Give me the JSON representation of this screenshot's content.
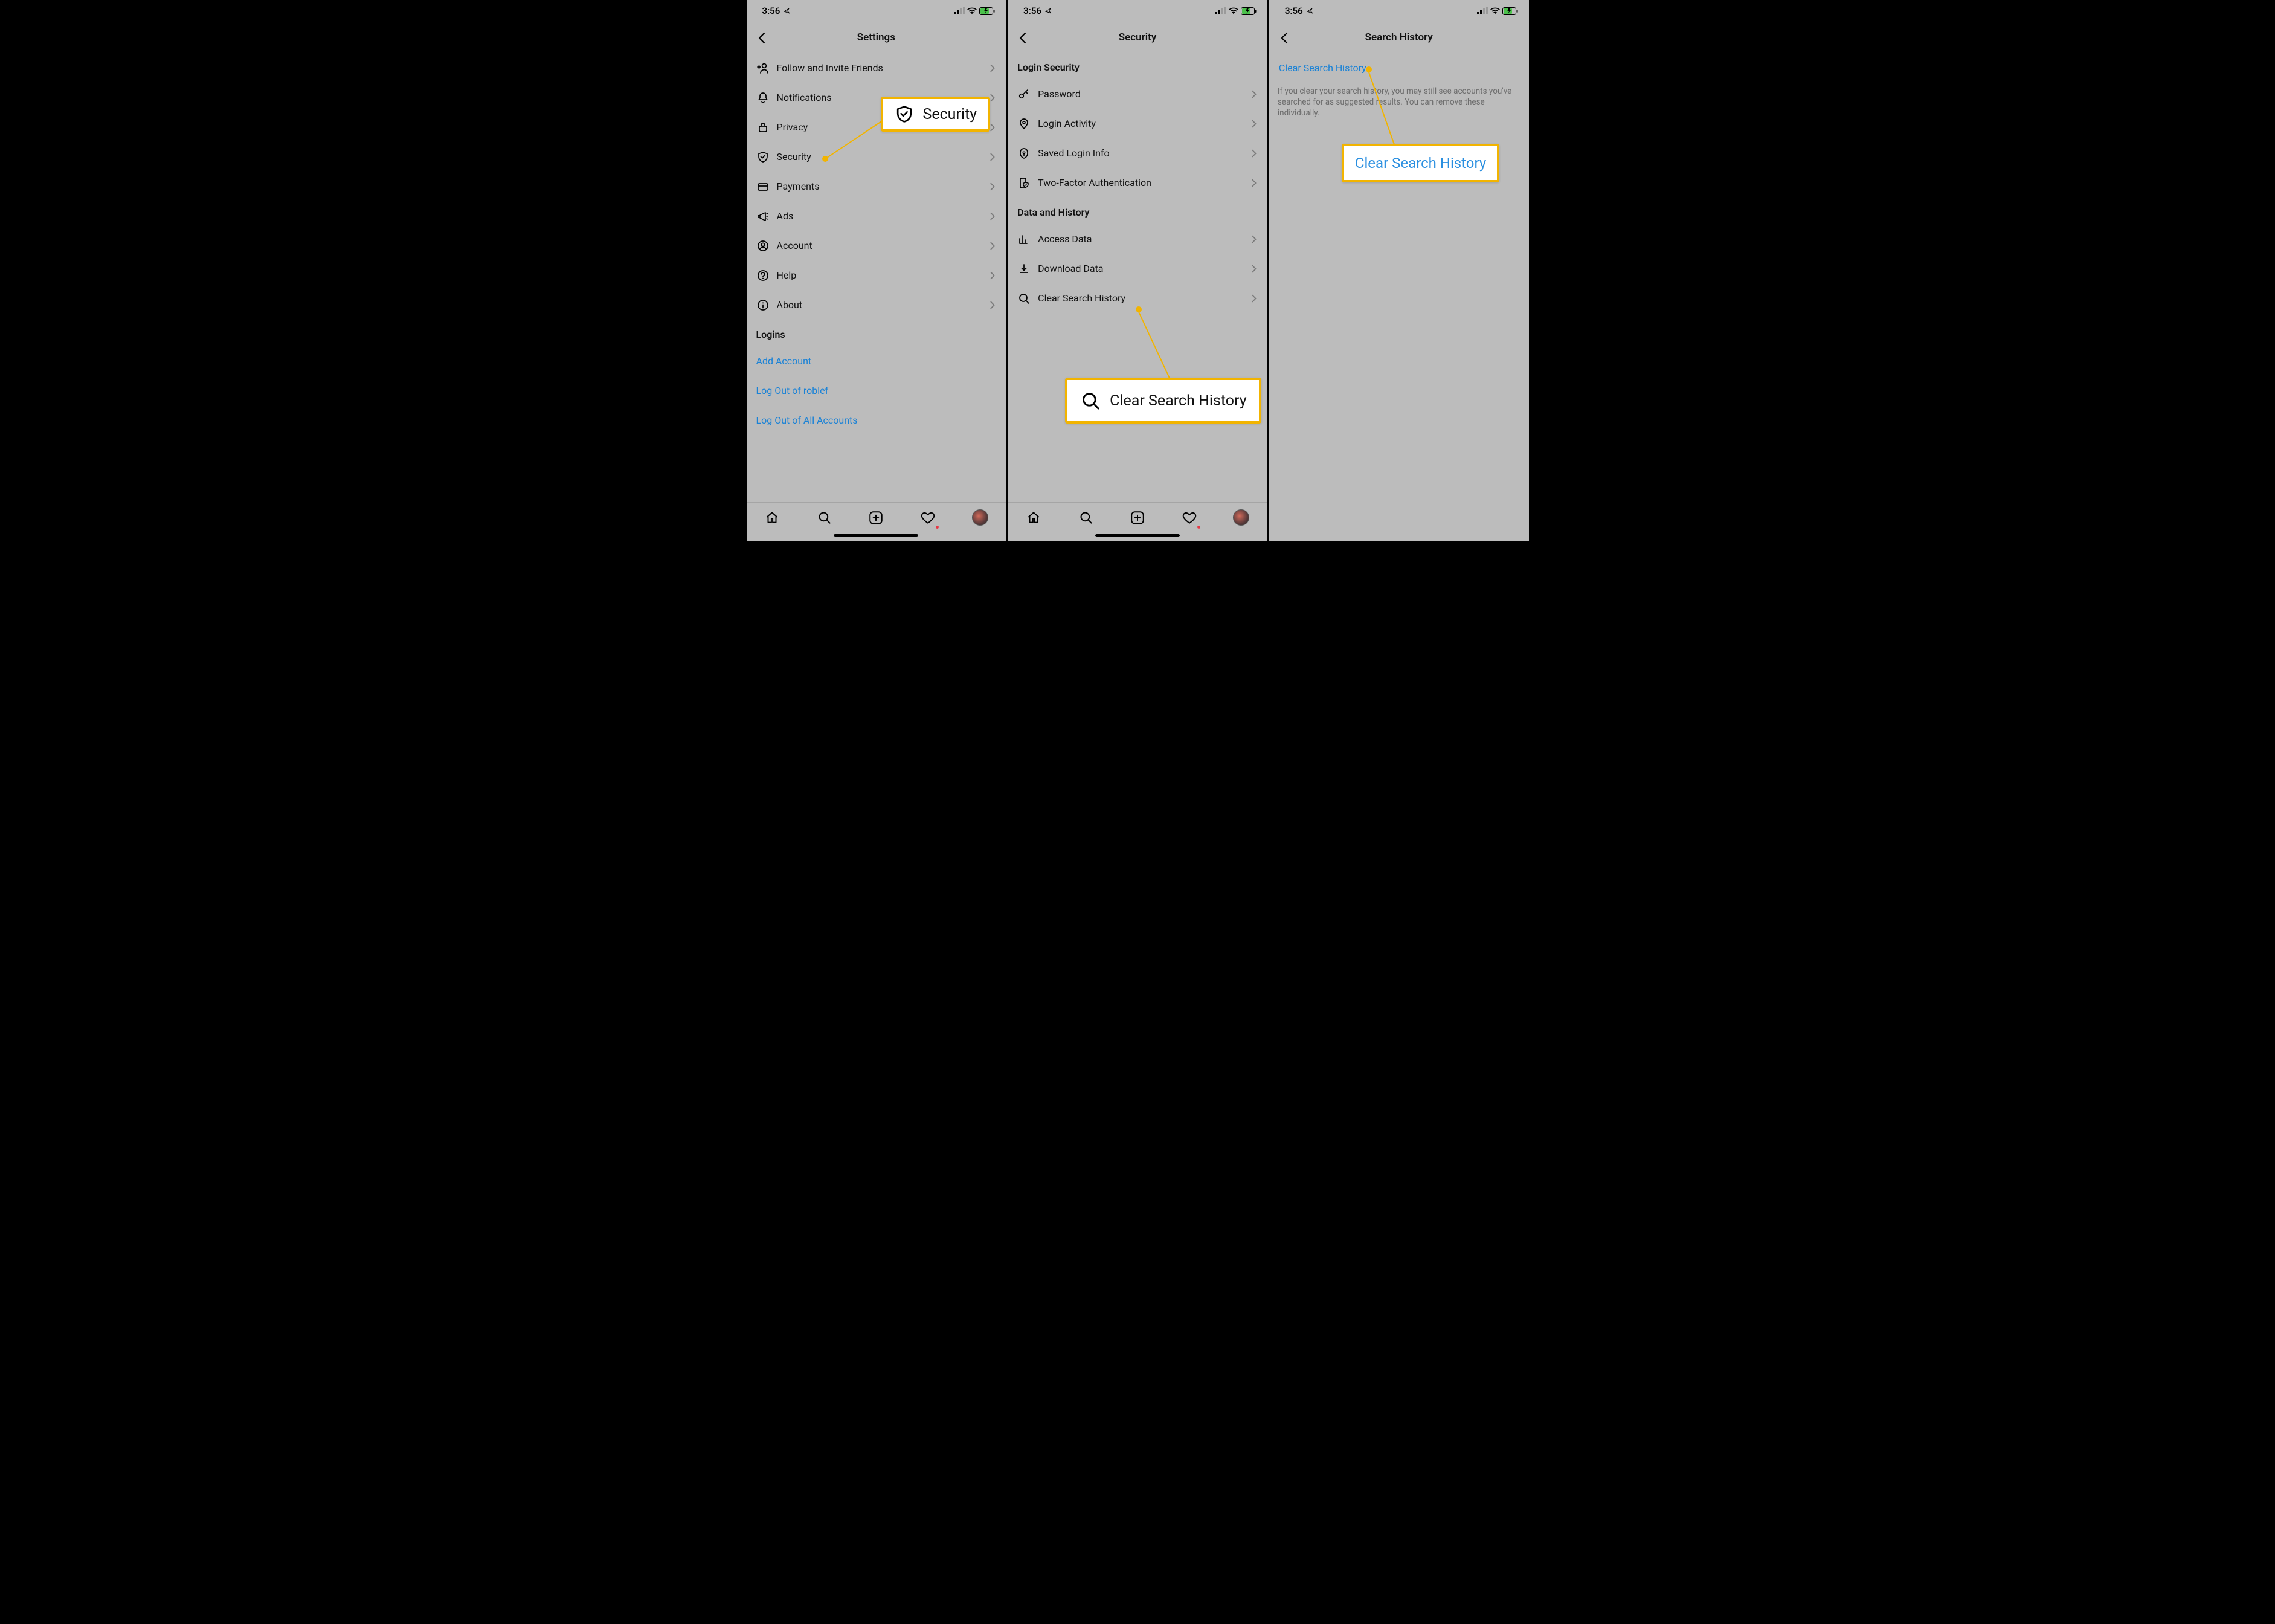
{
  "status": {
    "time": "3:56"
  },
  "screen1": {
    "title": "Settings",
    "items": [
      {
        "label": "Follow and Invite Friends",
        "icon": "add-user"
      },
      {
        "label": "Notifications",
        "icon": "bell"
      },
      {
        "label": "Privacy",
        "icon": "lock"
      },
      {
        "label": "Security",
        "icon": "shield"
      },
      {
        "label": "Payments",
        "icon": "card"
      },
      {
        "label": "Ads",
        "icon": "megaphone"
      },
      {
        "label": "Account",
        "icon": "account"
      },
      {
        "label": "Help",
        "icon": "help"
      },
      {
        "label": "About",
        "icon": "info"
      }
    ],
    "logins_header": "Logins",
    "links": [
      "Add Account",
      "Log Out of roblef",
      "Log Out of All Accounts"
    ],
    "callout": "Security"
  },
  "screen2": {
    "title": "Security",
    "section1": "Login Security",
    "items1": [
      {
        "label": "Password",
        "icon": "key"
      },
      {
        "label": "Login Activity",
        "icon": "pin"
      },
      {
        "label": "Saved Login Info",
        "icon": "keyhole"
      },
      {
        "label": "Two-Factor Authentication",
        "icon": "phone-shield"
      }
    ],
    "section2": "Data and History",
    "items2": [
      {
        "label": "Access Data",
        "icon": "bars"
      },
      {
        "label": "Download Data",
        "icon": "download"
      },
      {
        "label": "Clear Search History",
        "icon": "search"
      }
    ],
    "callout": "Clear Search History"
  },
  "screen3": {
    "title": "Search History",
    "clear_link": "Clear Search History",
    "desc": "If you clear your search history, you may still see accounts you've searched for as suggested results. You can remove these individually.",
    "callout": "Clear Search History"
  }
}
